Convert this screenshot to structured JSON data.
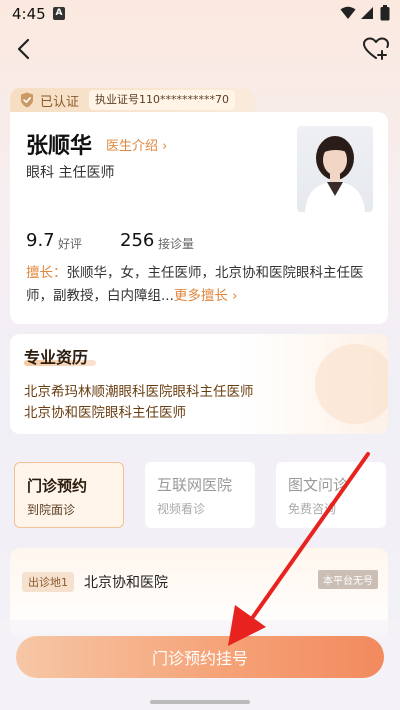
{
  "status_bar": {
    "time": "4:45",
    "notification_letter": "A"
  },
  "header": {
    "back_icon": "chevron-left-icon",
    "favorite_icon": "heart-plus-icon"
  },
  "certification": {
    "label": "已认证",
    "license": "执业证号110**********70",
    "icon": "shield-check-icon"
  },
  "doctor": {
    "name": "张顺华",
    "intro_link": "医生介绍 ›",
    "title": "眼科 主任医师",
    "rating_value": "9.7",
    "rating_label": "好评",
    "consult_count": "256",
    "consult_label": "接诊量",
    "specialty_label": "擅长：",
    "specialty_text": "张顺华，女，主任医师，北京协和医院眼科主任医师，副教授，白内障组...",
    "more_link": "更多擅长 ›"
  },
  "experience": {
    "title": "专业资历",
    "lines": [
      "北京希玛林顺潮眼科医院眼科主任医师",
      "北京协和医院眼科主任医师"
    ]
  },
  "tabs": [
    {
      "title": "门诊预约",
      "subtitle": "到院面诊"
    },
    {
      "title": "互联网医院",
      "subtitle": "视频看诊"
    },
    {
      "title": "图文问诊",
      "subtitle": "免费咨询"
    }
  ],
  "clinic": {
    "tag": "出诊地1",
    "name": "北京协和医院",
    "note": "本平台无号"
  },
  "action": {
    "book_label": "门诊预约挂号"
  },
  "colors": {
    "accent": "#e0873c",
    "button_start": "#f6c7a6",
    "button_end": "#f28a5e",
    "arrow": "#e8231f"
  }
}
